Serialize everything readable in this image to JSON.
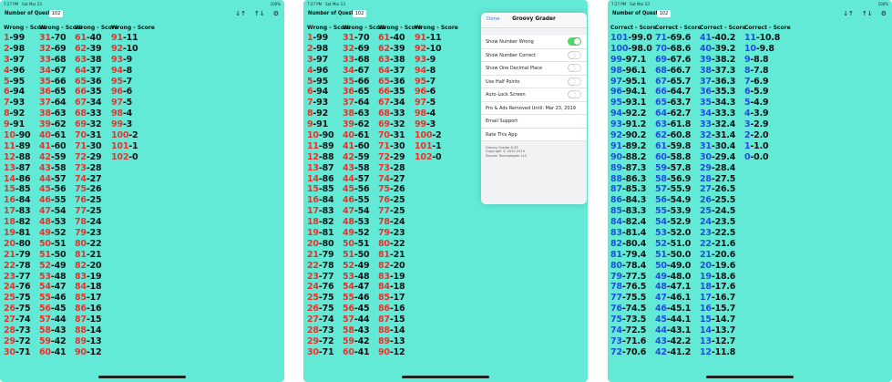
{
  "status_bar": {
    "time": "7:27 PM",
    "date": "Sat Mar 23",
    "right": "100%"
  },
  "toolbar": {
    "number_of_questions_label": "Number of Questions:",
    "number_of_questions_value": "102"
  },
  "panels": [
    {
      "headers": [
        "Wrong - Score",
        "Wrong - Score",
        "Wrong - Score",
        "Wrong - Score"
      ],
      "columns": [
        [
          [
            "1",
            "99"
          ],
          [
            "2",
            "98"
          ],
          [
            "3",
            "97"
          ],
          [
            "4",
            "96"
          ],
          [
            "5",
            "95"
          ],
          [
            "6",
            "94"
          ],
          [
            "7",
            "93"
          ],
          [
            "8",
            "92"
          ],
          [
            "9",
            "91"
          ],
          [
            "10",
            "90"
          ],
          [
            "11",
            "89"
          ],
          [
            "12",
            "88"
          ],
          [
            "13",
            "87"
          ],
          [
            "14",
            "86"
          ],
          [
            "15",
            "85"
          ],
          [
            "16",
            "84"
          ],
          [
            "17",
            "83"
          ],
          [
            "18",
            "82"
          ],
          [
            "19",
            "81"
          ],
          [
            "20",
            "80"
          ],
          [
            "21",
            "79"
          ],
          [
            "22",
            "78"
          ],
          [
            "23",
            "77"
          ],
          [
            "24",
            "76"
          ],
          [
            "25",
            "75"
          ],
          [
            "26",
            "75"
          ],
          [
            "27",
            "74"
          ],
          [
            "28",
            "73"
          ],
          [
            "29",
            "72"
          ],
          [
            "30",
            "71"
          ]
        ],
        [
          [
            "31",
            "70"
          ],
          [
            "32",
            "69"
          ],
          [
            "33",
            "68"
          ],
          [
            "34",
            "67"
          ],
          [
            "35",
            "66"
          ],
          [
            "36",
            "65"
          ],
          [
            "37",
            "64"
          ],
          [
            "38",
            "63"
          ],
          [
            "39",
            "62"
          ],
          [
            "40",
            "61"
          ],
          [
            "41",
            "60"
          ],
          [
            "42",
            "59"
          ],
          [
            "43",
            "58"
          ],
          [
            "44",
            "57"
          ],
          [
            "45",
            "56"
          ],
          [
            "46",
            "55"
          ],
          [
            "47",
            "54"
          ],
          [
            "48",
            "53"
          ],
          [
            "49",
            "52"
          ],
          [
            "50",
            "51"
          ],
          [
            "51",
            "50"
          ],
          [
            "52",
            "49"
          ],
          [
            "53",
            "48"
          ],
          [
            "54",
            "47"
          ],
          [
            "55",
            "46"
          ],
          [
            "56",
            "45"
          ],
          [
            "57",
            "44"
          ],
          [
            "58",
            "43"
          ],
          [
            "59",
            "42"
          ],
          [
            "60",
            "41"
          ]
        ],
        [
          [
            "61",
            "40"
          ],
          [
            "62",
            "39"
          ],
          [
            "63",
            "38"
          ],
          [
            "64",
            "37"
          ],
          [
            "65",
            "36"
          ],
          [
            "66",
            "35"
          ],
          [
            "67",
            "34"
          ],
          [
            "68",
            "33"
          ],
          [
            "69",
            "32"
          ],
          [
            "70",
            "31"
          ],
          [
            "71",
            "30"
          ],
          [
            "72",
            "29"
          ],
          [
            "73",
            "28"
          ],
          [
            "74",
            "27"
          ],
          [
            "75",
            "26"
          ],
          [
            "76",
            "25"
          ],
          [
            "77",
            "25"
          ],
          [
            "78",
            "24"
          ],
          [
            "79",
            "23"
          ],
          [
            "80",
            "22"
          ],
          [
            "81",
            "21"
          ],
          [
            "82",
            "20"
          ],
          [
            "83",
            "19"
          ],
          [
            "84",
            "18"
          ],
          [
            "85",
            "17"
          ],
          [
            "86",
            "16"
          ],
          [
            "87",
            "15"
          ],
          [
            "88",
            "14"
          ],
          [
            "89",
            "13"
          ],
          [
            "90",
            "12"
          ]
        ],
        [
          [
            "91",
            "11"
          ],
          [
            "92",
            "10"
          ],
          [
            "93",
            "9"
          ],
          [
            "94",
            "8"
          ],
          [
            "95",
            "7"
          ],
          [
            "96",
            "6"
          ],
          [
            "97",
            "5"
          ],
          [
            "98",
            "4"
          ],
          [
            "99",
            "3"
          ],
          [
            "100",
            "2"
          ],
          [
            "101",
            "1"
          ],
          [
            "102",
            "0"
          ]
        ]
      ]
    },
    {
      "headers": [
        "Correct - Score",
        "Correct - Score",
        "Correct - Score",
        "Correct - Score"
      ],
      "columns": [
        [
          [
            "101",
            "99.0"
          ],
          [
            "100",
            "98.0"
          ],
          [
            "99",
            "97.1"
          ],
          [
            "98",
            "96.1"
          ],
          [
            "97",
            "95.1"
          ],
          [
            "96",
            "94.1"
          ],
          [
            "95",
            "93.1"
          ],
          [
            "94",
            "92.2"
          ],
          [
            "93",
            "91.2"
          ],
          [
            "92",
            "90.2"
          ],
          [
            "91",
            "89.2"
          ],
          [
            "90",
            "88.2"
          ],
          [
            "89",
            "87.3"
          ],
          [
            "88",
            "86.3"
          ],
          [
            "87",
            "85.3"
          ],
          [
            "86",
            "84.3"
          ],
          [
            "85",
            "83.3"
          ],
          [
            "84",
            "82.4"
          ],
          [
            "83",
            "81.4"
          ],
          [
            "82",
            "80.4"
          ],
          [
            "81",
            "79.4"
          ],
          [
            "80",
            "78.4"
          ],
          [
            "79",
            "77.5"
          ],
          [
            "78",
            "76.5"
          ],
          [
            "77",
            "75.5"
          ],
          [
            "76",
            "74.5"
          ],
          [
            "75",
            "73.5"
          ],
          [
            "74",
            "72.5"
          ],
          [
            "73",
            "71.6"
          ],
          [
            "72",
            "70.6"
          ]
        ],
        [
          [
            "71",
            "69.6"
          ],
          [
            "70",
            "68.6"
          ],
          [
            "69",
            "67.6"
          ],
          [
            "68",
            "66.7"
          ],
          [
            "67",
            "65.7"
          ],
          [
            "66",
            "64.7"
          ],
          [
            "65",
            "63.7"
          ],
          [
            "64",
            "62.7"
          ],
          [
            "63",
            "61.8"
          ],
          [
            "62",
            "60.8"
          ],
          [
            "61",
            "59.8"
          ],
          [
            "60",
            "58.8"
          ],
          [
            "59",
            "57.8"
          ],
          [
            "58",
            "56.9"
          ],
          [
            "57",
            "55.9"
          ],
          [
            "56",
            "54.9"
          ],
          [
            "55",
            "53.9"
          ],
          [
            "54",
            "52.9"
          ],
          [
            "53",
            "52.0"
          ],
          [
            "52",
            "51.0"
          ],
          [
            "51",
            "50.0"
          ],
          [
            "50",
            "49.0"
          ],
          [
            "49",
            "48.0"
          ],
          [
            "48",
            "47.1"
          ],
          [
            "47",
            "46.1"
          ],
          [
            "46",
            "45.1"
          ],
          [
            "45",
            "44.1"
          ],
          [
            "44",
            "43.1"
          ],
          [
            "43",
            "42.2"
          ],
          [
            "42",
            "41.2"
          ]
        ],
        [
          [
            "41",
            "40.2"
          ],
          [
            "40",
            "39.2"
          ],
          [
            "39",
            "38.2"
          ],
          [
            "38",
            "37.3"
          ],
          [
            "37",
            "36.3"
          ],
          [
            "36",
            "35.3"
          ],
          [
            "35",
            "34.3"
          ],
          [
            "34",
            "33.3"
          ],
          [
            "33",
            "32.4"
          ],
          [
            "32",
            "31.4"
          ],
          [
            "31",
            "30.4"
          ],
          [
            "30",
            "29.4"
          ],
          [
            "29",
            "28.4"
          ],
          [
            "28",
            "27.5"
          ],
          [
            "27",
            "26.5"
          ],
          [
            "26",
            "25.5"
          ],
          [
            "25",
            "24.5"
          ],
          [
            "24",
            "23.5"
          ],
          [
            "23",
            "22.5"
          ],
          [
            "22",
            "21.6"
          ],
          [
            "21",
            "20.6"
          ],
          [
            "20",
            "19.6"
          ],
          [
            "19",
            "18.6"
          ],
          [
            "18",
            "17.6"
          ],
          [
            "17",
            "16.7"
          ],
          [
            "16",
            "15.7"
          ],
          [
            "15",
            "14.7"
          ],
          [
            "14",
            "13.7"
          ],
          [
            "13",
            "12.7"
          ],
          [
            "12",
            "11.8"
          ]
        ],
        [
          [
            "11",
            "10.8"
          ],
          [
            "10",
            "9.8"
          ],
          [
            "9",
            "8.8"
          ],
          [
            "8",
            "7.8"
          ],
          [
            "7",
            "6.9"
          ],
          [
            "6",
            "5.9"
          ],
          [
            "5",
            "4.9"
          ],
          [
            "4",
            "3.9"
          ],
          [
            "3",
            "2.9"
          ],
          [
            "2",
            "2.0"
          ],
          [
            "1",
            "1.0"
          ],
          [
            "0",
            "0.0"
          ]
        ]
      ]
    }
  ],
  "settings_popover": {
    "done_label": "Done",
    "title": "Groovy Grader",
    "items": [
      {
        "label": "Show Number Wrong",
        "toggle": true
      },
      {
        "label": "Show Number Correct",
        "toggle": false
      },
      {
        "label": "Show One Decimal Place",
        "toggle": false
      },
      {
        "label": "Use Half Points",
        "toggle": false
      },
      {
        "label": "Auto-Lock Screen",
        "toggle": false
      },
      {
        "label": "Pro & Ads Removed Until: Mar 23, 2019"
      },
      {
        "label": "Email Support"
      },
      {
        "label": "Rate This App"
      }
    ],
    "footer": [
      "Groovy Grader 6.33",
      "Copyright © 2010-2019",
      "Dryrain Technologies LLC"
    ]
  },
  "colors": {
    "background": "#63ead6",
    "wrong": "#e8322b",
    "correct": "#1f4fe0",
    "score": "#141414"
  },
  "icons": [
    "sort-descending-icon",
    "sort-ascending-icon",
    "gear-icon"
  ]
}
